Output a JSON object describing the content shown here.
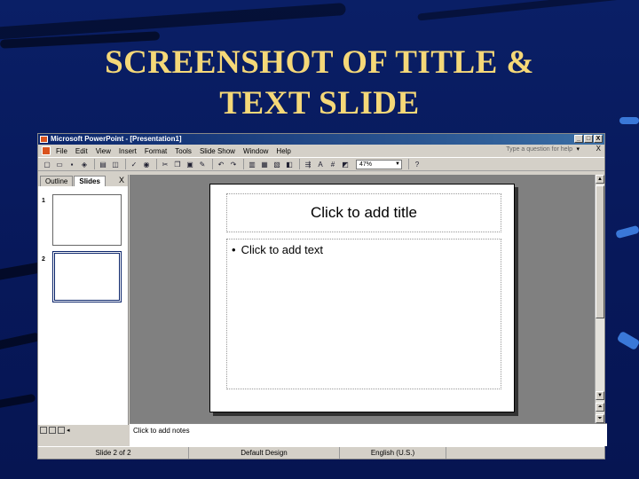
{
  "slide": {
    "title_line1": "SCREENSHOT OF TITLE &",
    "title_line2": "TEXT SLIDE"
  },
  "window": {
    "title": "Microsoft PowerPoint - [Presentation1]",
    "buttons": [
      "_",
      "□",
      "X"
    ]
  },
  "menubar": {
    "items": [
      "File",
      "Edit",
      "View",
      "Insert",
      "Format",
      "Tools",
      "Slide Show",
      "Window",
      "Help"
    ],
    "ask_placeholder": "Type a question for help",
    "close": "X"
  },
  "toolbar": {
    "zoom": "47%"
  },
  "left_pane": {
    "tabs": [
      "Outline",
      "Slides"
    ],
    "close": "X",
    "slide_numbers": [
      "1",
      "2"
    ]
  },
  "editor": {
    "title_placeholder": "Click to add title",
    "body_placeholder": "Click to add text",
    "bullet": "•",
    "notes_placeholder": "Click to add notes"
  },
  "statusbar": {
    "slide_position": "Slide 2 of 2",
    "design": "Default Design",
    "language": "English (U.S.)"
  },
  "colors": {
    "background": "#0a1f66",
    "title_gold": "#f5d878",
    "window_chrome": "#d4d0c8",
    "titlebar_blue": "#0a246a"
  }
}
